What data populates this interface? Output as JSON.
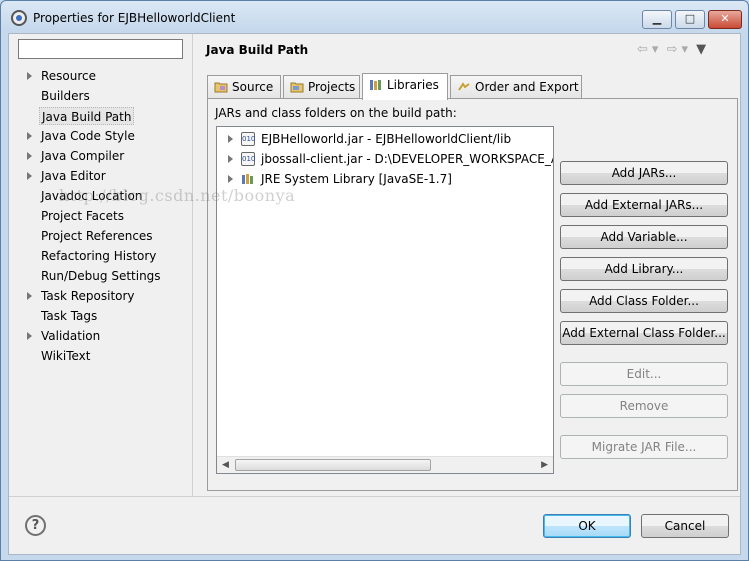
{
  "window": {
    "title": "Properties for EJBHelloworldClient",
    "controls": {
      "minimize": "▁",
      "maximize": "□",
      "close": "✕"
    }
  },
  "filter": {
    "value": "",
    "placeholder": ""
  },
  "nav": {
    "items": [
      {
        "label": "Resource",
        "expandable": true
      },
      {
        "label": "Builders",
        "expandable": false
      },
      {
        "label": "Java Build Path",
        "expandable": false,
        "selected": true
      },
      {
        "label": "Java Code Style",
        "expandable": true
      },
      {
        "label": "Java Compiler",
        "expandable": true
      },
      {
        "label": "Java Editor",
        "expandable": true
      },
      {
        "label": "Javadoc Location",
        "expandable": false
      },
      {
        "label": "Project Facets",
        "expandable": false
      },
      {
        "label": "Project References",
        "expandable": false
      },
      {
        "label": "Refactoring History",
        "expandable": false
      },
      {
        "label": "Run/Debug Settings",
        "expandable": false
      },
      {
        "label": "Task Repository",
        "expandable": true
      },
      {
        "label": "Task Tags",
        "expandable": false
      },
      {
        "label": "Validation",
        "expandable": true
      },
      {
        "label": "WikiText",
        "expandable": false
      }
    ]
  },
  "page": {
    "title": "Java Build Path",
    "history": {
      "back": "⇦",
      "back_menu": "▾",
      "forward": "⇨",
      "forward_menu": "▾",
      "menu": "▼"
    }
  },
  "tabs": [
    {
      "label": "Source",
      "icon": "source-folder-icon"
    },
    {
      "label": "Projects",
      "icon": "projects-icon"
    },
    {
      "label": "Libraries",
      "icon": "libraries-icon",
      "active": true
    },
    {
      "label": "Order and Export",
      "icon": "order-export-icon"
    }
  ],
  "libraries": {
    "subtitle": "JARs and class folders on the build path:",
    "entries": [
      {
        "label": "EJBHelloworld.jar - EJBHelloworldClient/lib",
        "icon": "jar-icon"
      },
      {
        "label": "jbossall-client.jar - D:\\DEVELOPER_WORKSPACE_A...",
        "icon": "jar-icon"
      },
      {
        "label": "JRE System Library [JavaSE-1.7]",
        "icon": "library-icon"
      }
    ],
    "jar_icon_text": "010",
    "scroll_left": "◀",
    "scroll_right": "▶"
  },
  "buttons": {
    "add_jars": "Add JARs...",
    "add_external_jars": "Add External JARs...",
    "add_variable": "Add Variable...",
    "add_library": "Add Library...",
    "add_class_folder": "Add Class Folder...",
    "add_external_class_folder": "Add External Class Folder...",
    "edit": "Edit...",
    "remove": "Remove",
    "migrate_jar": "Migrate JAR File..."
  },
  "watermark": "http://blog.csdn.net/boonya",
  "footer": {
    "help": "?",
    "ok": "OK",
    "cancel": "Cancel"
  },
  "colors": {
    "accent": "#3c7fb1",
    "title_bar": "#c5d8ec"
  }
}
